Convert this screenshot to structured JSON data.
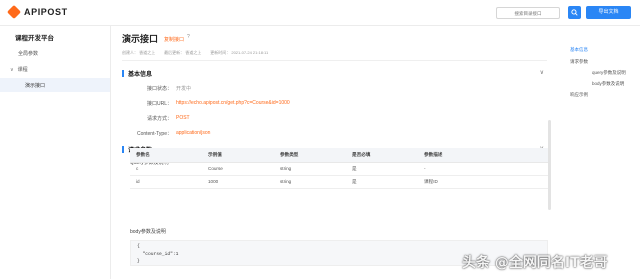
{
  "app": {
    "logo_text": "APIPOST",
    "search_placeholder": "搜索目录接口",
    "export_label": "导出文档"
  },
  "sidebar": {
    "project_title": "课程开发平台",
    "items": [
      {
        "label": "全局参数"
      },
      {
        "label": "课程"
      },
      {
        "label": "演示接口"
      }
    ]
  },
  "page": {
    "title": "演示接口",
    "copy_link": "复制接口",
    "help": "?",
    "meta": {
      "creator": "创建人：  香道之上",
      "last_updater": "最后更新：  香道之上",
      "updated_at": "更新时间：  2021-07-24 21:18:11"
    }
  },
  "basic": {
    "title": "基本信息",
    "rows": [
      {
        "label": "接口状态：",
        "value": "开发中"
      },
      {
        "label": "接口URL：",
        "value": "https://echo.apipost.cn/get.php?c=Course&id=1000"
      },
      {
        "label": "请求方式：",
        "value": "POST"
      },
      {
        "label": "Content-Type：",
        "value": "application/json"
      }
    ]
  },
  "request": {
    "title": "请求参数",
    "query_title": "Query参数及说明",
    "columns": [
      "参数名",
      "示例值",
      "参数类型",
      "是否必填",
      "参数描述"
    ],
    "rows": [
      [
        "c",
        "Course",
        "string",
        "是",
        "-"
      ],
      [
        "id",
        "1000",
        "string",
        "是",
        "课程ID"
      ]
    ],
    "body_title": "body参数及说明",
    "body_lines": [
      "{",
      "  \"course_id\":1",
      "}"
    ]
  },
  "toc": {
    "items": [
      {
        "label": "基本信息",
        "active": true
      },
      {
        "label": "请求参数"
      },
      {
        "label": "query参数及说明"
      },
      {
        "label": "body参数及说明"
      },
      {
        "label": "响应示例"
      }
    ]
  },
  "overlay": {
    "watermark": "头条 @全网同名IT老哥"
  },
  "colors": {
    "accent": "#2a86f5",
    "brand": "#ff6a1a"
  },
  "icons": [
    "logo-mark-icon",
    "search-icon",
    "help-icon",
    "chevron-down-icon"
  ]
}
